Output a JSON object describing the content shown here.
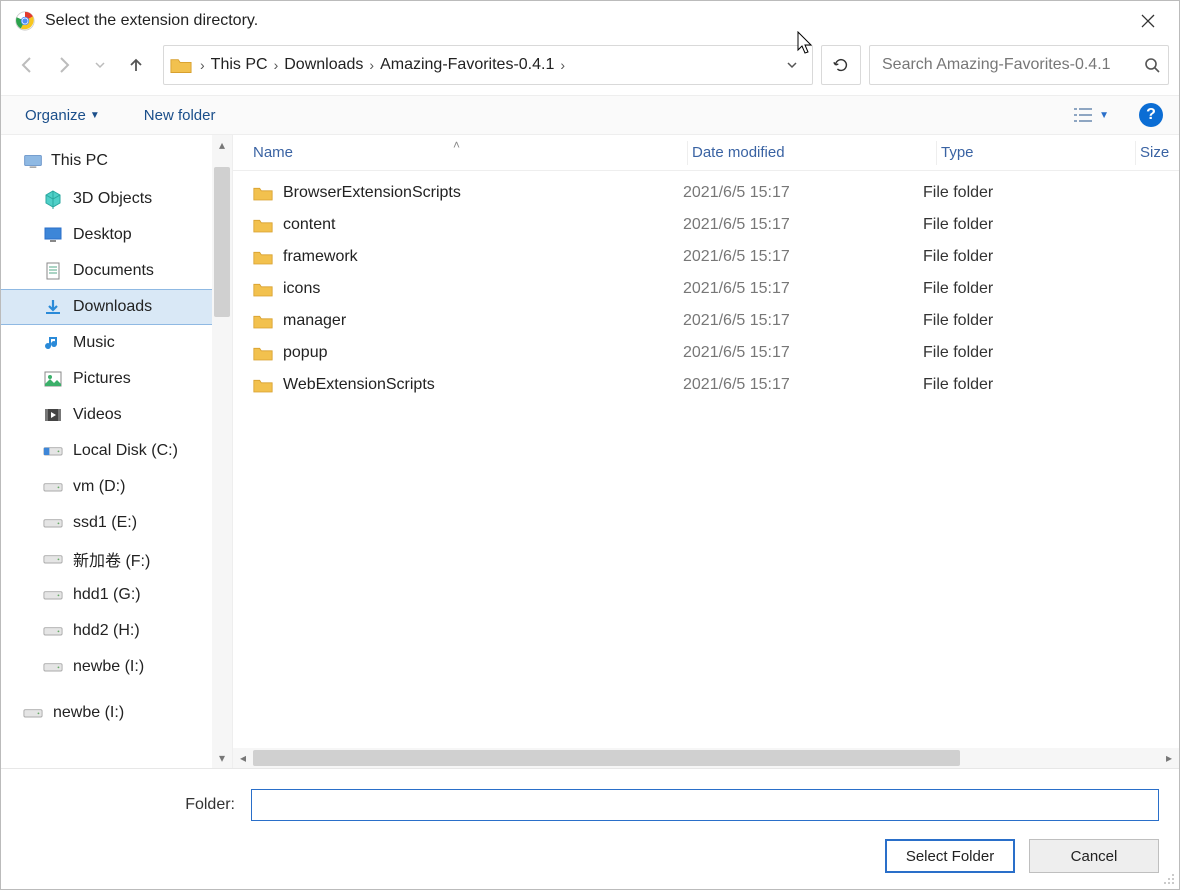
{
  "window": {
    "title": "Select the extension directory."
  },
  "breadcrumb": {
    "items": [
      "This PC",
      "Downloads",
      "Amazing-Favorites-0.4.1"
    ]
  },
  "search": {
    "placeholder": "Search Amazing-Favorites-0.4.1"
  },
  "toolbar": {
    "organize": "Organize",
    "new_folder": "New folder"
  },
  "tree": {
    "header": "This PC",
    "items": [
      {
        "label": "3D Objects",
        "icon": "cube"
      },
      {
        "label": "Desktop",
        "icon": "desktop"
      },
      {
        "label": "Documents",
        "icon": "doc"
      },
      {
        "label": "Downloads",
        "icon": "download",
        "selected": true
      },
      {
        "label": "Music",
        "icon": "music"
      },
      {
        "label": "Pictures",
        "icon": "picture"
      },
      {
        "label": "Videos",
        "icon": "video"
      },
      {
        "label": "Local Disk (C:)",
        "icon": "disk-c"
      },
      {
        "label": "vm (D:)",
        "icon": "disk"
      },
      {
        "label": "ssd1 (E:)",
        "icon": "disk"
      },
      {
        "label": "新加卷 (F:)",
        "icon": "disk"
      },
      {
        "label": "hdd1 (G:)",
        "icon": "disk"
      },
      {
        "label": "hdd2 (H:)",
        "icon": "disk"
      },
      {
        "label": "newbe (I:)",
        "icon": "disk"
      }
    ],
    "extra": {
      "label": "newbe (I:)",
      "icon": "disk"
    }
  },
  "columns": {
    "name": "Name",
    "date": "Date modified",
    "type": "Type",
    "size": "Size"
  },
  "files": [
    {
      "name": "BrowserExtensionScripts",
      "date": "2021/6/5 15:17",
      "type": "File folder"
    },
    {
      "name": "content",
      "date": "2021/6/5 15:17",
      "type": "File folder"
    },
    {
      "name": "framework",
      "date": "2021/6/5 15:17",
      "type": "File folder"
    },
    {
      "name": "icons",
      "date": "2021/6/5 15:17",
      "type": "File folder"
    },
    {
      "name": "manager",
      "date": "2021/6/5 15:17",
      "type": "File folder"
    },
    {
      "name": "popup",
      "date": "2021/6/5 15:17",
      "type": "File folder"
    },
    {
      "name": "WebExtensionScripts",
      "date": "2021/6/5 15:17",
      "type": "File folder"
    }
  ],
  "footer": {
    "folder_label": "Folder:",
    "folder_value": "",
    "select_btn": "Select Folder",
    "cancel_btn": "Cancel"
  }
}
